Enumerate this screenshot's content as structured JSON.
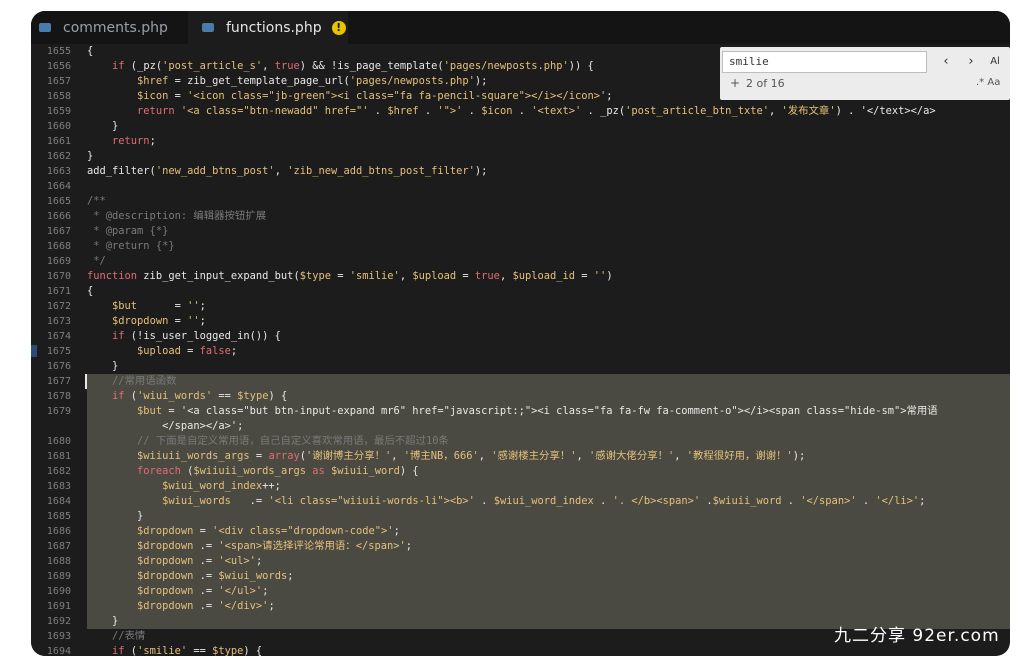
{
  "tabs": [
    {
      "label": "comments.php",
      "active": false
    },
    {
      "label": "functions.php",
      "active": true,
      "modified_mark": "!"
    }
  ],
  "search": {
    "value": "smilie",
    "count": "2 of 16",
    "prev": "‹",
    "next": "›",
    "case_label": "Aa",
    "regex_label": ".*",
    "whole_word_label": "Al",
    "plus": "+"
  },
  "colors": {
    "background": "#1c1c1c",
    "keyword": "#e06c75",
    "string": "#e5c07b",
    "comment": "#7a7a7a",
    "selection": "#4a4a42"
  },
  "watermark": "九二分享 92er.com",
  "lines": [
    {
      "n": "1655",
      "text": "{"
    },
    {
      "n": "1656",
      "text": "    if (_pz('post_article_s', true) && !is_page_template('pages/newposts.php')) {"
    },
    {
      "n": "1657",
      "text": "        $href = zib_get_template_page_url('pages/newposts.php');"
    },
    {
      "n": "1658",
      "text": "        $icon = '<icon class=\"jb-green\"><i class=\"fa fa-pencil-square\"></i></icon>';"
    },
    {
      "n": "1659",
      "text": "        return '<a class=\"btn-newadd\" href=\"' . $href . '\">' . $icon . '<text>' . _pz('post_article_btn_txte', '发布文章') . '</text></a>"
    },
    {
      "n": "1660",
      "text": "    }"
    },
    {
      "n": "1661",
      "text": "    return;"
    },
    {
      "n": "1662",
      "text": "}"
    },
    {
      "n": "1663",
      "text": "add_filter('new_add_btns_post', 'zib_new_add_btns_post_filter');"
    },
    {
      "n": "1664",
      "text": ""
    },
    {
      "n": "1665",
      "text": "/**"
    },
    {
      "n": "1666",
      "text": " * @description: 编辑器按钮扩展"
    },
    {
      "n": "1667",
      "text": " * @param {*}"
    },
    {
      "n": "1668",
      "text": " * @return {*}"
    },
    {
      "n": "1669",
      "text": " */"
    },
    {
      "n": "1670",
      "text": "function zib_get_input_expand_but($type = 'smilie', $upload = true, $upload_id = '')"
    },
    {
      "n": "1671",
      "text": "{"
    },
    {
      "n": "1672",
      "text": "    $but      = '';"
    },
    {
      "n": "1673",
      "text": "    $dropdown = '';"
    },
    {
      "n": "1674",
      "text": "    if (!is_user_logged_in()) {"
    },
    {
      "n": "1675",
      "text": "        $upload = false;"
    },
    {
      "n": "1676",
      "text": "    }"
    },
    {
      "n": "1677",
      "text": "    //常用语函数"
    },
    {
      "n": "1678",
      "text": "    if ('wiui_words' == $type) {"
    },
    {
      "n": "1679",
      "text": "        $but = '<a class=\"but btn-input-expand mr6\" href=\"javascript:;\"><i class=\"fa fa-fw fa-comment-o\"></i><span class=\"hide-sm\">常用语"
    },
    {
      "n": "",
      "text": "            </span></a>';"
    },
    {
      "n": "1680",
      "text": "        // 下面是自定义常用语，自己自定义喜欢常用语，最后不超过10条"
    },
    {
      "n": "1681",
      "text": "        $wiiuii_words_args = array('谢谢博主分享！', '博主NB，666', '感谢楼主分享！', '感谢大佬分享！', '教程很好用，谢谢！');"
    },
    {
      "n": "1682",
      "text": "        foreach ($wiiuii_words_args as $wiuii_word) {"
    },
    {
      "n": "1683",
      "text": "            $wiui_word_index++;"
    },
    {
      "n": "1684",
      "text": "            $wiui_words   .= '<li class=\"wiiuii-words-li\"><b>' . $wiui_word_index . '. </b><span>' .$wiuii_word . '</span>' . '</li>';"
    },
    {
      "n": "1685",
      "text": "        }"
    },
    {
      "n": "1686",
      "text": "        $dropdown = '<div class=\"dropdown-code\">';"
    },
    {
      "n": "1687",
      "text": "        $dropdown .= '<span>请选择评论常用语：</span>';"
    },
    {
      "n": "1688",
      "text": "        $dropdown .= '<ul>';"
    },
    {
      "n": "1689",
      "text": "        $dropdown .= $wiui_words;"
    },
    {
      "n": "1690",
      "text": "        $dropdown .= '</ul>';"
    },
    {
      "n": "1691",
      "text": "        $dropdown .= '</div>';"
    },
    {
      "n": "1692",
      "text": "    }"
    },
    {
      "n": "1693",
      "text": "    //表情"
    },
    {
      "n": "1694",
      "text": "    if ('smilie' == $type) {"
    }
  ]
}
